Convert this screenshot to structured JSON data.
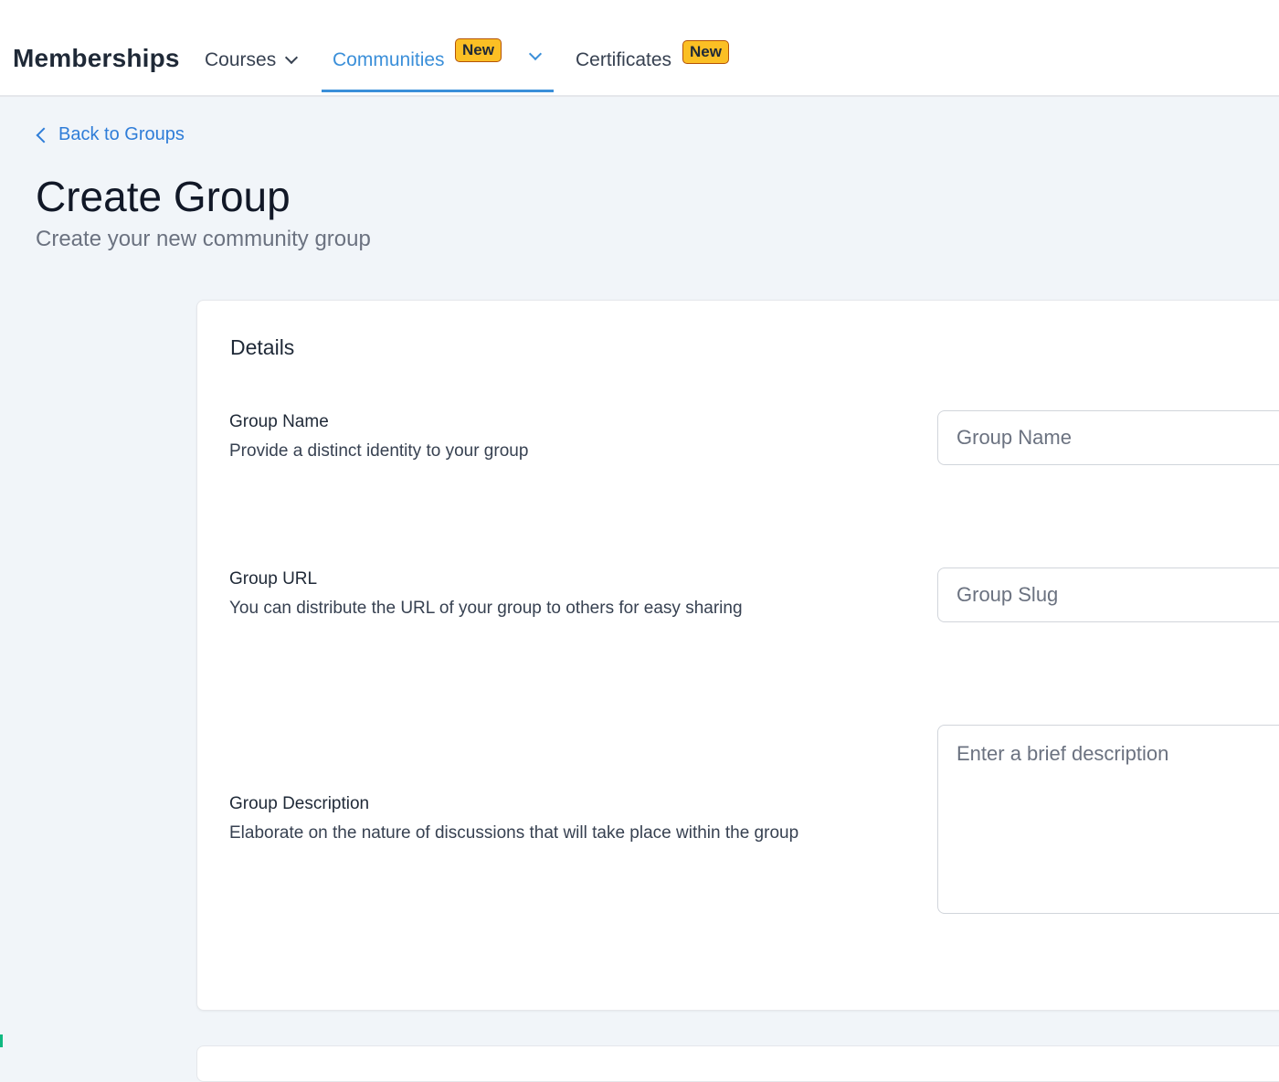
{
  "header": {
    "brand": "Memberships",
    "nav": {
      "courses": "Courses",
      "communities": "Communities",
      "certificates": "Certificates"
    },
    "badges": {
      "communities_badge": "New",
      "certificates_badge": "New"
    }
  },
  "breadcrumb": {
    "back_label": "Back to Groups"
  },
  "page": {
    "title": "Create Group",
    "subtitle": "Create your new community group"
  },
  "details_card": {
    "title": "Details",
    "group_name": {
      "label": "Group Name",
      "help": "Provide a distinct identity to your group",
      "placeholder": "Group Name",
      "value": ""
    },
    "group_url": {
      "label": "Group URL",
      "help": "You can distribute the URL of your group to others for easy sharing",
      "placeholder": "Group Slug",
      "value": ""
    },
    "group_description": {
      "label": "Group Description",
      "help": "Elaborate on the nature of discussions that will take place within the group",
      "placeholder": "Enter a brief description",
      "value": ""
    }
  },
  "icons": {
    "courses_dropdown": "chevron-down-icon",
    "communities_dropdown": "chevron-down-icon",
    "back": "chevron-left-icon"
  },
  "colors": {
    "accent": "#3b8fd9",
    "badge": "#fbbf24",
    "page_bg": "#f1f5f9"
  }
}
